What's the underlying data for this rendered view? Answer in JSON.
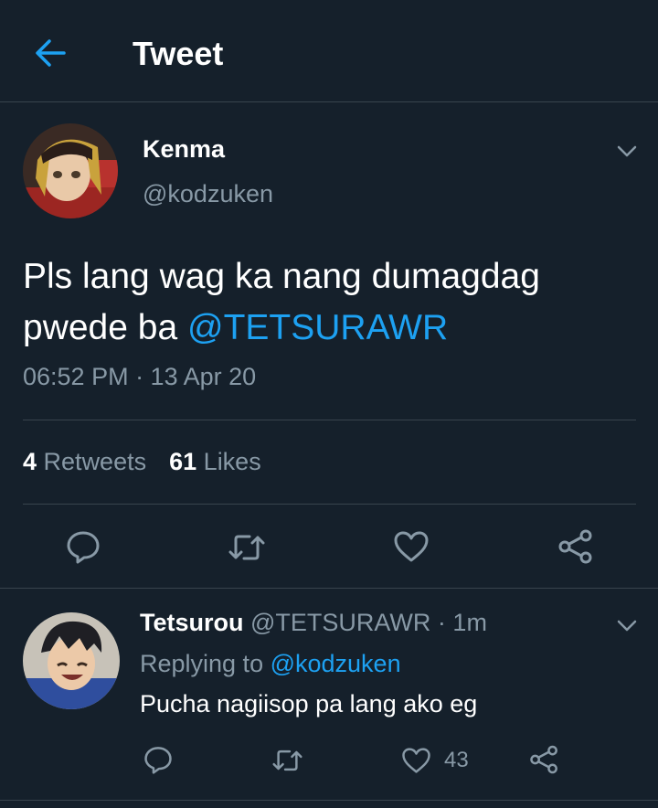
{
  "header": {
    "title": "Tweet",
    "back_icon": "arrow-left-icon"
  },
  "colors": {
    "background": "#15202b",
    "accent": "#1da1f2",
    "muted": "#8899a6",
    "divider": "#38444d"
  },
  "main_tweet": {
    "name": "Kenma",
    "handle": "@kodzuken",
    "text": "Pls lang wag ka nang dumagdag pwede ba ",
    "mention": "@TETSURAWR",
    "timestamp": "06:52 PM · 13 Apr 20",
    "retweets_count": "4",
    "retweets_label": "Retweets",
    "likes_count": "61",
    "likes_label": "Likes",
    "actions": [
      "reply-icon",
      "retweet-icon",
      "like-icon",
      "share-icon"
    ]
  },
  "reply": {
    "name": "Tetsurou",
    "handle": "@TETSURAWR",
    "separator": " · ",
    "time": "1m",
    "replying_prefix": "Replying to ",
    "replying_handle": "@kodzuken",
    "text": "Pucha nagiisop pa lang ako eg",
    "like_count": "43",
    "actions": [
      "reply-icon",
      "retweet-icon",
      "like-icon",
      "share-icon"
    ]
  }
}
